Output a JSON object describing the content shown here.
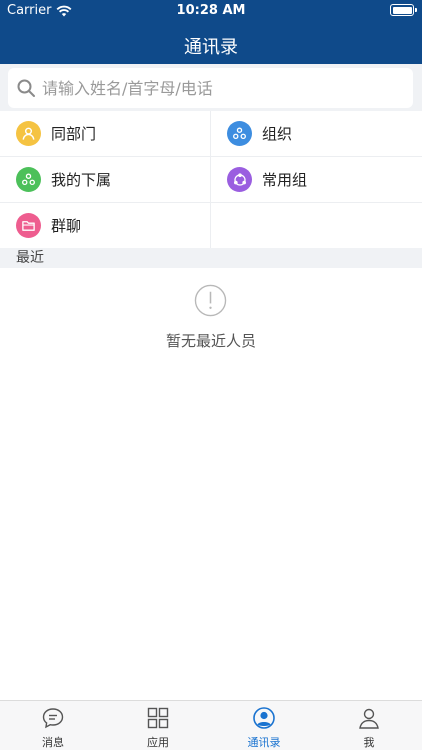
{
  "status_bar": {
    "carrier": "Carrier",
    "time": "10:28 AM"
  },
  "nav": {
    "title": "通讯录"
  },
  "search": {
    "placeholder": "请输入姓名/首字母/电话"
  },
  "quick_items": [
    {
      "label": "同部门",
      "icon": "person-icon",
      "color": "#f5c342"
    },
    {
      "label": "组织",
      "icon": "org-icon",
      "color": "#3d8de0"
    },
    {
      "label": "我的下属",
      "icon": "subordinate-icon",
      "color": "#4cc05a"
    },
    {
      "label": "常用组",
      "icon": "group-icon",
      "color": "#9a5ee0"
    },
    {
      "label": "群聊",
      "icon": "folder-icon",
      "color": "#ee5d8f"
    }
  ],
  "recent": {
    "section_label": "最近",
    "empty_text": "暂无最近人员"
  },
  "tabs": [
    {
      "label": "消息",
      "icon": "message-icon",
      "active": false
    },
    {
      "label": "应用",
      "icon": "apps-icon",
      "active": false
    },
    {
      "label": "通讯录",
      "icon": "contacts-icon",
      "active": true
    },
    {
      "label": "我",
      "icon": "profile-icon",
      "active": false
    }
  ],
  "colors": {
    "header_bg": "#0f4a8a",
    "active_tab": "#1a73d0"
  }
}
